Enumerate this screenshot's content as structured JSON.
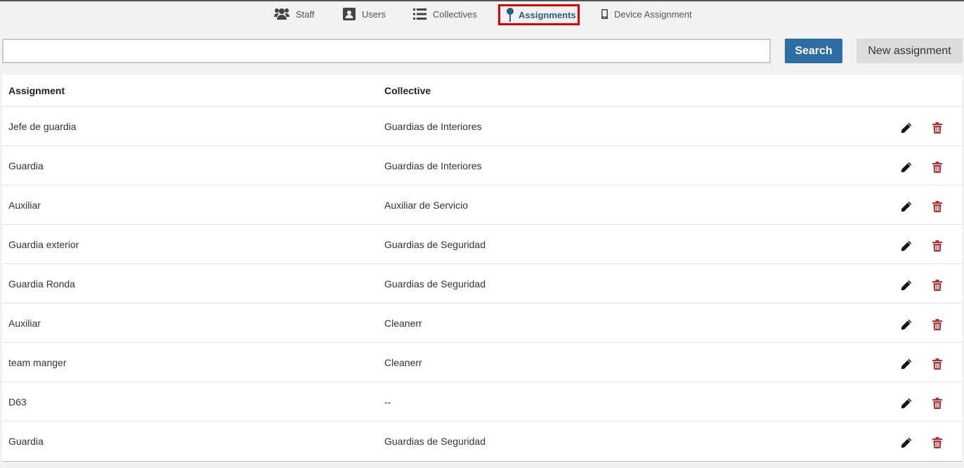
{
  "nav": {
    "staff": "Staff",
    "users": "Users",
    "collectives": "Collectives",
    "assignments": "Assignments",
    "device": "Device Assignment"
  },
  "search": {
    "value": "",
    "button": "Search",
    "new_button": "New assignment"
  },
  "table": {
    "headers": {
      "assignment": "Assignment",
      "collective": "Collective"
    },
    "rows": [
      {
        "assignment": "Jefe de guardia",
        "collective": "Guardias de Interiores"
      },
      {
        "assignment": "Guardia",
        "collective": "Guardias de Interiores"
      },
      {
        "assignment": "Auxiliar",
        "collective": "Auxiliar de Servicio"
      },
      {
        "assignment": "Guardia exterior",
        "collective": "Guardias de Seguridad"
      },
      {
        "assignment": "Guardia Ronda",
        "collective": "Guardias de Seguridad"
      },
      {
        "assignment": "Auxiliar",
        "collective": "Cleanerr"
      },
      {
        "assignment": "team manger",
        "collective": "Cleanerr"
      },
      {
        "assignment": "D63",
        "collective": "--"
      },
      {
        "assignment": "Guardia",
        "collective": "Guardias de Seguridad"
      }
    ]
  },
  "icons": {
    "staff": "users-group-icon",
    "users": "address-book-icon",
    "collectives": "list-icon",
    "assignments": "pin-icon",
    "device": "mobile-icon",
    "edit": "pencil-icon",
    "delete": "trash-icon"
  },
  "colors": {
    "accent": "#2e6da4",
    "highlight_border": "#e00000",
    "delete": "#b03030"
  }
}
